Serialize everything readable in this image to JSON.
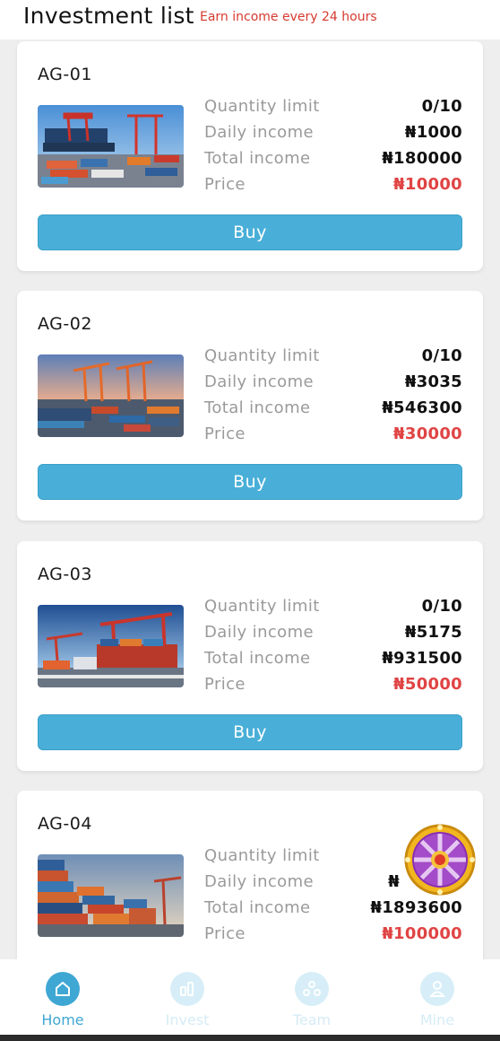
{
  "header": {
    "title": "Investment list",
    "subtitle": "Earn income every 24 hours"
  },
  "products": [
    {
      "name": "AG-01",
      "labels": {
        "quantity": "Quantity limit",
        "daily": "Daily income",
        "total": "Total income",
        "price": "Price"
      },
      "quantity": "0/10",
      "daily_income": "₦1000",
      "total_income": "₦180000",
      "price": "₦10000",
      "buy_label": "Buy"
    },
    {
      "name": "AG-02",
      "labels": {
        "quantity": "Quantity limit",
        "daily": "Daily income",
        "total": "Total income",
        "price": "Price"
      },
      "quantity": "0/10",
      "daily_income": "₦3035",
      "total_income": "₦546300",
      "price": "₦30000",
      "buy_label": "Buy"
    },
    {
      "name": "AG-03",
      "labels": {
        "quantity": "Quantity limit",
        "daily": "Daily income",
        "total": "Total income",
        "price": "Price"
      },
      "quantity": "0/10",
      "daily_income": "₦5175",
      "total_income": "₦931500",
      "price": "₦50000",
      "buy_label": "Buy"
    },
    {
      "name": "AG-04",
      "labels": {
        "quantity": "Quantity limit",
        "daily": "Daily income",
        "total": "Total income",
        "price": "Price"
      },
      "quantity": "",
      "daily_income": "₦",
      "total_income": "₦1893600",
      "price": "₦100000"
    }
  ],
  "tabbar": {
    "items": [
      {
        "label": "Home",
        "icon": "home-icon",
        "active": true
      },
      {
        "label": "Invest",
        "icon": "invest-icon",
        "active": false
      },
      {
        "label": "Team",
        "icon": "team-icon",
        "active": false
      },
      {
        "label": "Mine",
        "icon": "mine-icon",
        "active": false
      }
    ]
  },
  "colors": {
    "accent": "#49afd8",
    "price": "#e04444",
    "subtitle": "#d63a2f"
  }
}
